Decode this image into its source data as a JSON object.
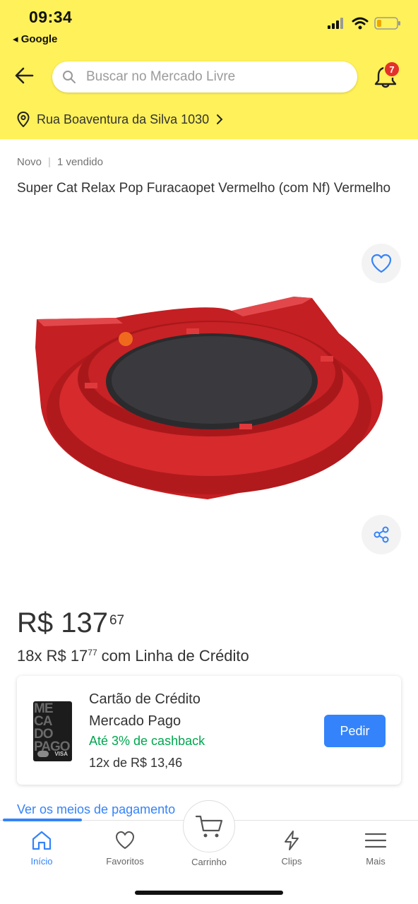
{
  "status_bar": {
    "time": "09:34",
    "back_app": "Google"
  },
  "header": {
    "search_placeholder": "Buscar no Mercado Livre",
    "notification_count": "7",
    "address": "Rua Boaventura da Silva 1030",
    "accent_color": "#fff159"
  },
  "product": {
    "condition": "Novo",
    "sold": "1 vendido",
    "title": "Super Cat Relax Pop Furacaopet Vermelho (com Nf) Vermelho",
    "image_alt": "Arranhador vermelho em formato de cabeça de gato",
    "price_main": "R$ 137",
    "price_cents": "67",
    "installments_prefix": "18x R$ 17",
    "installments_cents": "77",
    "installments_suffix": "com Linha de Crédito"
  },
  "credit_card": {
    "title_line1": "Cartão de Crédito",
    "title_line2": "Mercado Pago",
    "cashback": "Até 3% de cashback",
    "installments": "12x de R$ 13,46",
    "button": "Pedir",
    "card_logo_text": "ME CA DO PAGO",
    "card_brand": "VISA"
  },
  "payment_link": "Ver os meios de pagamento",
  "tabbar": {
    "items": [
      {
        "label": "Início",
        "icon": "home-icon",
        "active": true
      },
      {
        "label": "Favoritos",
        "icon": "heart-icon",
        "active": false
      },
      {
        "label": "Carrinho",
        "icon": "cart-icon",
        "active": false
      },
      {
        "label": "Clips",
        "icon": "clips-icon",
        "active": false
      },
      {
        "label": "Mais",
        "icon": "menu-icon",
        "active": false
      }
    ],
    "active_color": "#3483fa"
  }
}
